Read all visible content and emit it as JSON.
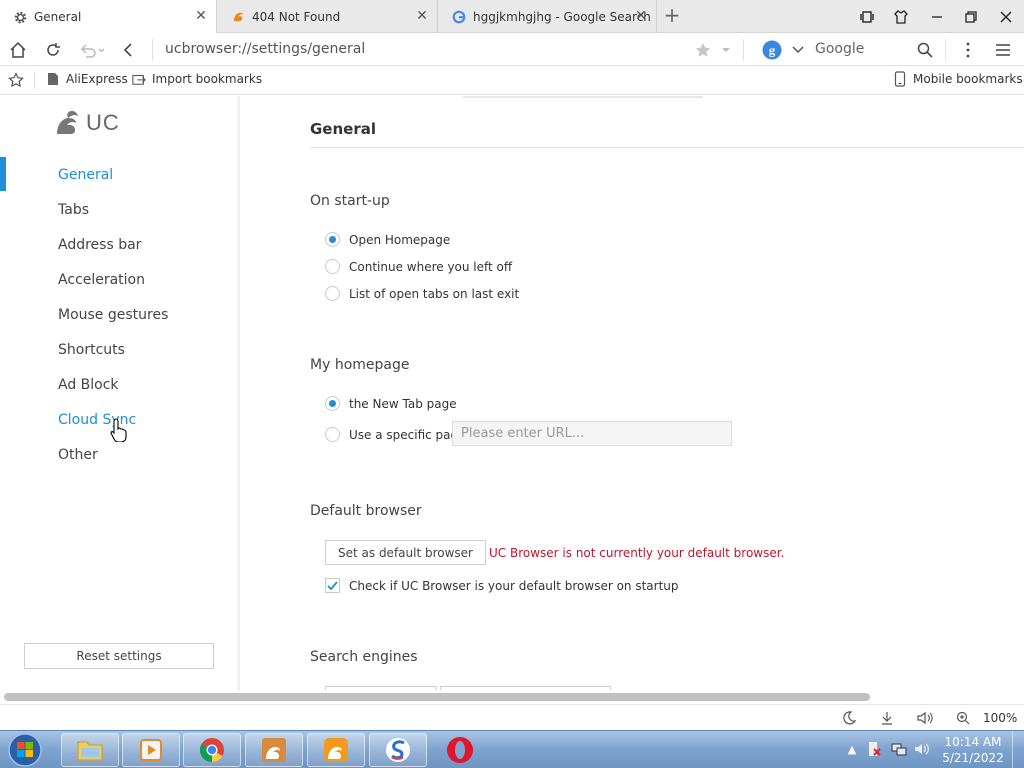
{
  "tabs": [
    {
      "label": "General",
      "icon": "gear-icon",
      "active": true
    },
    {
      "label": "404 Not Found",
      "icon": "uc-squirrel-icon",
      "active": false
    },
    {
      "label": "hggjkmhgjhg - Google Search",
      "icon": "google-icon",
      "active": false
    }
  ],
  "address": {
    "url": "ucbrowser://settings/general",
    "search_engine": "Google"
  },
  "bookmarks": {
    "items": [
      "AliExpress",
      "Import bookmarks"
    ],
    "mobile": "Mobile bookmarks"
  },
  "sidebar": {
    "logo": "UC",
    "items": [
      {
        "label": "General"
      },
      {
        "label": "Tabs"
      },
      {
        "label": "Address bar"
      },
      {
        "label": "Acceleration"
      },
      {
        "label": "Mouse gestures"
      },
      {
        "label": "Shortcuts"
      },
      {
        "label": "Ad Block"
      },
      {
        "label": "Cloud Sync"
      },
      {
        "label": "Other"
      }
    ],
    "reset_label": "Reset settings"
  },
  "main": {
    "title": "General",
    "startup": {
      "heading": "On start-up",
      "options": [
        "Open Homepage",
        "Continue where you left off",
        "List of open tabs on last exit"
      ],
      "selected": 0
    },
    "homepage": {
      "heading": "My homepage",
      "options": [
        "the New Tab page",
        "Use a specific page"
      ],
      "selected": 0,
      "url_placeholder": "Please enter URL..."
    },
    "default_browser": {
      "heading": "Default browser",
      "button": "Set as default browser",
      "warning": "UC Browser is not currently your default browser.",
      "check_label": "Check if UC Browser is your default browser on startup",
      "checked": true
    },
    "search_engines": {
      "heading": "Search engines"
    }
  },
  "status": {
    "zoom": "100%"
  },
  "taskbar": {
    "time": "10:14 AM",
    "date": "5/21/2022"
  },
  "colors": {
    "accent": "#1f8ed8",
    "warning": "#c0162b"
  }
}
